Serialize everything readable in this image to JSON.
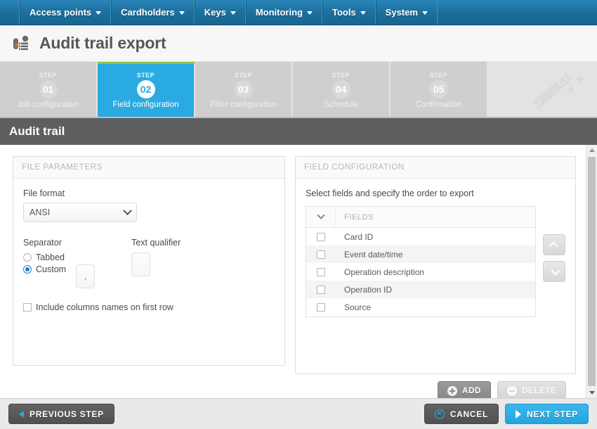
{
  "navbar": {
    "items": [
      {
        "label": "Access points",
        "icon": "chevron-down-icon"
      },
      {
        "label": "Cardholders",
        "icon": "chevron-down-icon"
      },
      {
        "label": "Keys",
        "icon": "chevron-down-icon"
      },
      {
        "label": "Monitoring",
        "icon": "chevron-down-icon"
      },
      {
        "label": "Tools",
        "icon": "chevron-down-icon"
      },
      {
        "label": "System",
        "icon": "chevron-down-icon"
      }
    ]
  },
  "page": {
    "title": "Audit trail export",
    "title_icon": "audit-trail-icon",
    "decor_icon": "magic-wand-icon",
    "section_title": "Audit trail"
  },
  "steps": {
    "word": "STEP",
    "items": [
      {
        "num": "01",
        "label": "Job configuration",
        "active": false
      },
      {
        "num": "02",
        "label": "Field configuration",
        "active": true
      },
      {
        "num": "03",
        "label": "Filter configuration",
        "active": false
      },
      {
        "num": "04",
        "label": "Schedule",
        "active": false
      },
      {
        "num": "05",
        "label": "Confirmation",
        "active": false
      }
    ],
    "active_accent": "#8cc63f",
    "active_bg": "#29abe2"
  },
  "file_parameters": {
    "panel_title": "FILE PARAMETERS",
    "file_format_label": "File format",
    "file_format_value": "ANSI",
    "file_format_options": [
      "ANSI"
    ],
    "separator_label": "Separator",
    "separator_options": [
      {
        "label": "Tabbed",
        "selected": false
      },
      {
        "label": "Custom",
        "selected": true
      }
    ],
    "separator_custom_value": ",",
    "text_qualifier_label": "Text qualifier",
    "text_qualifier_value": "",
    "include_columns_label": "Include columns names on first row",
    "include_columns_checked": false
  },
  "field_configuration": {
    "panel_title": "FIELD CONFIGURATION",
    "hint": "Select fields and specify the order to export",
    "table": {
      "select_all_icon": "chevron-down-icon",
      "header": "FIELDS",
      "rows": [
        {
          "label": "Card ID",
          "checked": false
        },
        {
          "label": "Event date/time",
          "checked": false
        },
        {
          "label": "Operation description",
          "checked": false
        },
        {
          "label": "Operation ID",
          "checked": false
        },
        {
          "label": "Source",
          "checked": false
        }
      ]
    },
    "order_up_icon": "chevron-up-icon",
    "order_down_icon": "chevron-down-icon",
    "add_label": "ADD",
    "delete_label": "DELETE",
    "add_icon": "plus-circle-icon",
    "delete_icon": "minus-circle-icon"
  },
  "scrollbar": {
    "up_icon": "triangle-up-icon",
    "down_icon": "triangle-down-icon"
  },
  "bottom_bar": {
    "previous_label": "PREVIOUS STEP",
    "previous_icon": "chevron-left-icon",
    "cancel_label": "CANCEL",
    "cancel_icon": "close-circle-icon",
    "next_label": "NEXT STEP",
    "next_icon": "chevron-right-icon"
  }
}
